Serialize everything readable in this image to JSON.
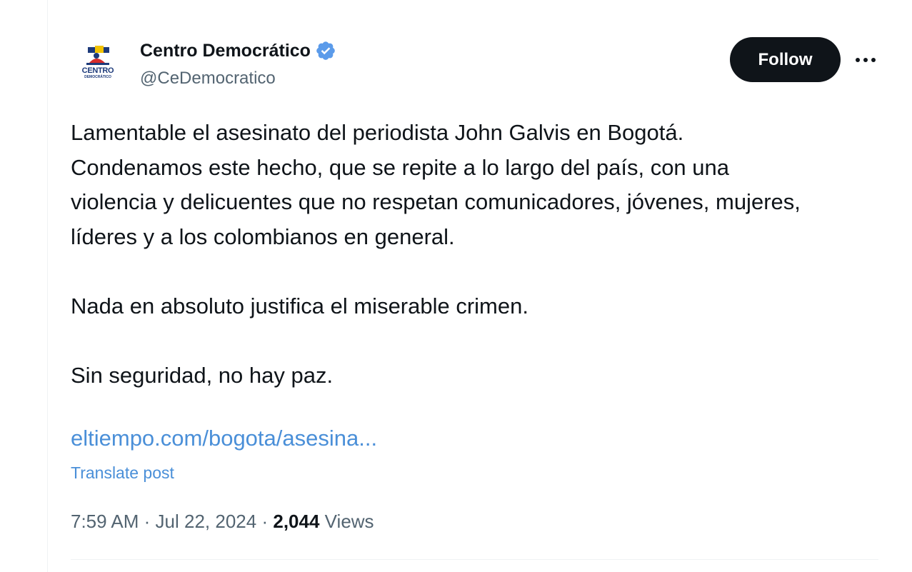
{
  "author": {
    "display_name": "Centro Democrático",
    "handle": "@CeDemocratico",
    "verified": true,
    "avatar_text": "CENTRO",
    "avatar_subtext": "DEMOCRÁTICO"
  },
  "actions": {
    "follow_label": "Follow",
    "more_icon": "more-horizontal-icon"
  },
  "post": {
    "paragraphs": [
      "Lamentable el asesinato del periodista John Galvis en Bogotá. Condenamos este hecho, que se repite a lo largo del país, con una violencia y delicuentes que no respetan comunicadores, jóvenes, mujeres, líderes y a los colombianos en general.",
      "Nada en absoluto justifica el miserable crimen.",
      "Sin seguridad, no hay paz."
    ],
    "link_text": "eltiempo.com/bogota/asesina...",
    "translate_label": "Translate post"
  },
  "meta": {
    "time": "7:59 AM",
    "separator": "·",
    "date": "Jul 22, 2024",
    "views_count": "2,044",
    "views_label": "Views"
  },
  "colors": {
    "text": "#0f1419",
    "secondary": "#536471",
    "link": "#4a8fd8",
    "verified": "#5b9bea",
    "follow_bg": "#0f1419"
  }
}
